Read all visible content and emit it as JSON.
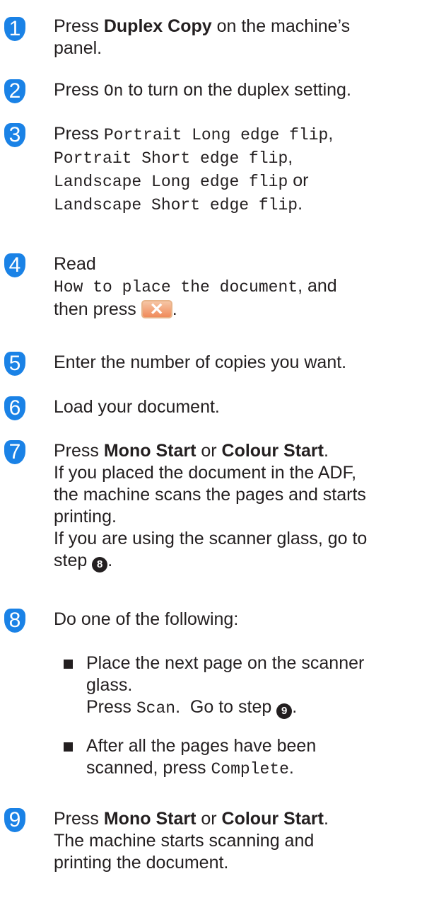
{
  "accent_color": "#1a82e6",
  "steps": {
    "s1": {
      "num": "1",
      "press": "Press ",
      "button": "Duplex Copy",
      "rest": " on the machine’s",
      "line2": "panel."
    },
    "s2": {
      "num": "2",
      "press": "Press ",
      "option": "On",
      "rest": " to turn on the duplex setting."
    },
    "s3": {
      "num": "3",
      "press": "Press ",
      "opt1": "Portrait Long edge flip",
      "c1": ",",
      "opt2": "Portrait Short edge flip",
      "c2": ",",
      "opt3": "Landscape Long edge flip",
      "or": " or",
      "opt4": "Landscape Short edge flip",
      "end": "."
    },
    "s4": {
      "num": "4",
      "read": "Read",
      "link": "How to place the document",
      "and": ", and",
      "then": "then press ",
      "icon": "close-icon",
      "x_glyph": "✕",
      "end": "."
    },
    "s5": {
      "num": "5",
      "text": "Enter the number of copies you want."
    },
    "s6": {
      "num": "6",
      "text": "Load your document."
    },
    "s7": {
      "num": "7",
      "press": "Press ",
      "mono": "Mono Start",
      "or": " or ",
      "colour": "Colour Start",
      "end": ".",
      "l2": "If you placed the document in the ADF,",
      "l3": "the machine scans the pages and starts",
      "l4": "printing.",
      "l5": "If you are using the scanner glass, go to",
      "l6": "step ",
      "ref": "8",
      "end2": "."
    },
    "s8": {
      "num": "8",
      "text": "Do one of the following:",
      "b1_l1": "Place the next page on the scanner",
      "b1_l2": "glass.",
      "b1_press": "Press ",
      "b1_scan": "Scan",
      "b1_goto": ".  Go to step ",
      "b1_ref": "9",
      "b1_end": ".",
      "b2_l1": "After all the pages have been",
      "b2_scanned": "scanned, press ",
      "b2_complete": "Complete",
      "b2_end": "."
    },
    "s9": {
      "num": "9",
      "press": "Press ",
      "mono": "Mono Start",
      "or": " or ",
      "colour": "Colour Start",
      "end": ".",
      "l2": "The machine starts scanning and",
      "l3": "printing the document."
    }
  }
}
